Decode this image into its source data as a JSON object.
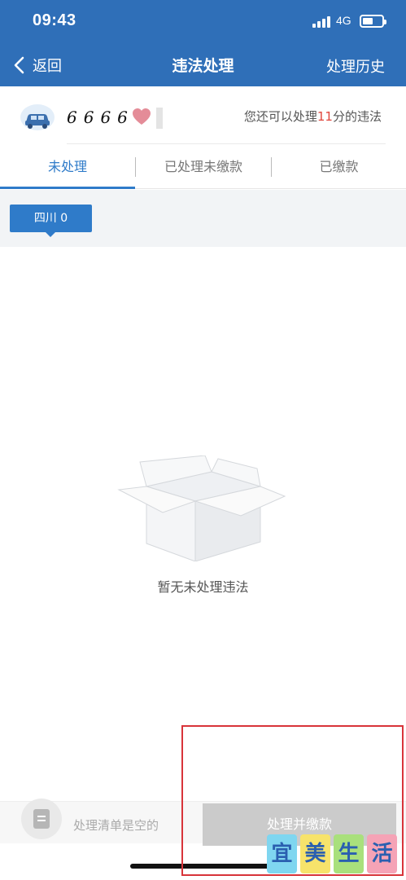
{
  "status_bar": {
    "time": "09:43",
    "network": "4G"
  },
  "nav": {
    "back_label": "返回",
    "title": "违法处理",
    "history_label": "处理历史"
  },
  "vehicle": {
    "plate_visible": "6666",
    "remaining_prefix": "您还可以处理",
    "remaining_points": "11",
    "remaining_suffix": "分的违法"
  },
  "tabs": [
    {
      "label": "未处理",
      "active": true
    },
    {
      "label": "已处理未缴款",
      "active": false
    },
    {
      "label": "已缴款",
      "active": false
    }
  ],
  "region": {
    "chip_label": "四川 0"
  },
  "empty_state": {
    "message": "暂无未处理违法"
  },
  "bottom_bar": {
    "list_empty_text": "处理清单是空的",
    "pay_button_label": "处理并缴款"
  },
  "watermark": {
    "chars": [
      "宜",
      "美",
      "生",
      "活"
    ]
  },
  "colors": {
    "header_bg": "#2f6fb8",
    "accent": "#2f7bc9",
    "points_red": "#e0463c",
    "disabled_button": "#cbcbcb",
    "annotation_frame": "#d8343a"
  },
  "icons": [
    "signal-icon",
    "battery-icon",
    "back-chevron-icon",
    "car-avatar-icon",
    "heart-icon",
    "empty-box-icon",
    "list-icon"
  ]
}
